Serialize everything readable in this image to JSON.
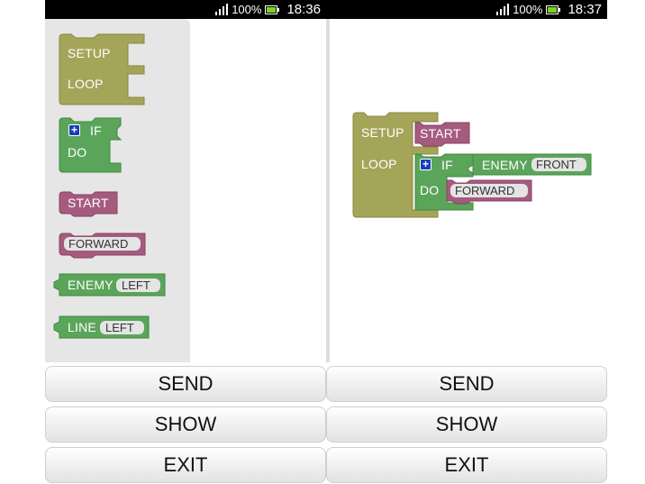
{
  "screens": [
    {
      "status": {
        "battery": "100%",
        "time": "18:36"
      },
      "toolbox": {
        "setup_block": {
          "setup_label": "SETUP",
          "loop_label": "LOOP"
        },
        "if_block": {
          "if_label": "IF",
          "do_label": "DO"
        },
        "start_block": {
          "label": "START"
        },
        "forward_block": {
          "label": "FORWARD"
        },
        "enemy_block": {
          "label": "ENEMY",
          "value": "LEFT"
        },
        "line_block": {
          "label": "LINE",
          "value": "LEFT"
        }
      },
      "buttons": {
        "send": "SEND",
        "show": "SHOW",
        "exit": "EXIT"
      }
    },
    {
      "status": {
        "battery": "100%",
        "time": "18:37"
      },
      "program": {
        "setup_label": "SETUP",
        "loop_label": "LOOP",
        "start_label": "START",
        "if_label": "IF",
        "do_label": "DO",
        "enemy_label": "ENEMY",
        "enemy_value": "FRONT",
        "forward_label": "FORWARD"
      },
      "buttons": {
        "send": "SEND",
        "show": "SHOW",
        "exit": "EXIT"
      }
    }
  ],
  "colors": {
    "olive_block": "#a5a55a",
    "green_block": "#5ba55b",
    "pink_block": "#a55b80",
    "status_bar": "#000000",
    "toolbox_bg": "#e6e6e6"
  }
}
